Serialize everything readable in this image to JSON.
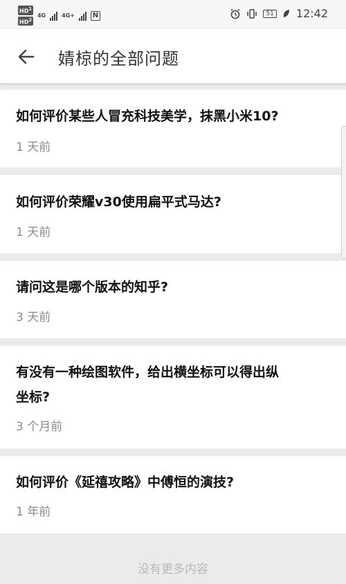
{
  "status": {
    "hd1": "HD",
    "hd1_sub": "1",
    "hd2": "HD",
    "hd2_sub": "2",
    "net1": "4G",
    "net2": "4G+",
    "nfc": "N",
    "battery": "51",
    "time": "12:42"
  },
  "header": {
    "title": "婧椋的全部问题"
  },
  "questions": [
    {
      "title": "如何评价某些人冒充科技美学，抹黑小米10?",
      "time": "1 天前"
    },
    {
      "title": "如何评价荣耀v30使用扁平式马达?",
      "time": "1 天前"
    },
    {
      "title": "请问这是哪个版本的知乎?",
      "time": "3 天前"
    },
    {
      "title_line1": "有没有一种绘图软件，给出横坐标可以得出纵",
      "title_line2": "坐标?",
      "time": "3 个月前"
    },
    {
      "title": "如何评价《延禧攻略》中傅恒的演技?",
      "time": "1 年前"
    }
  ],
  "footer": {
    "text": "没有更多内容"
  }
}
